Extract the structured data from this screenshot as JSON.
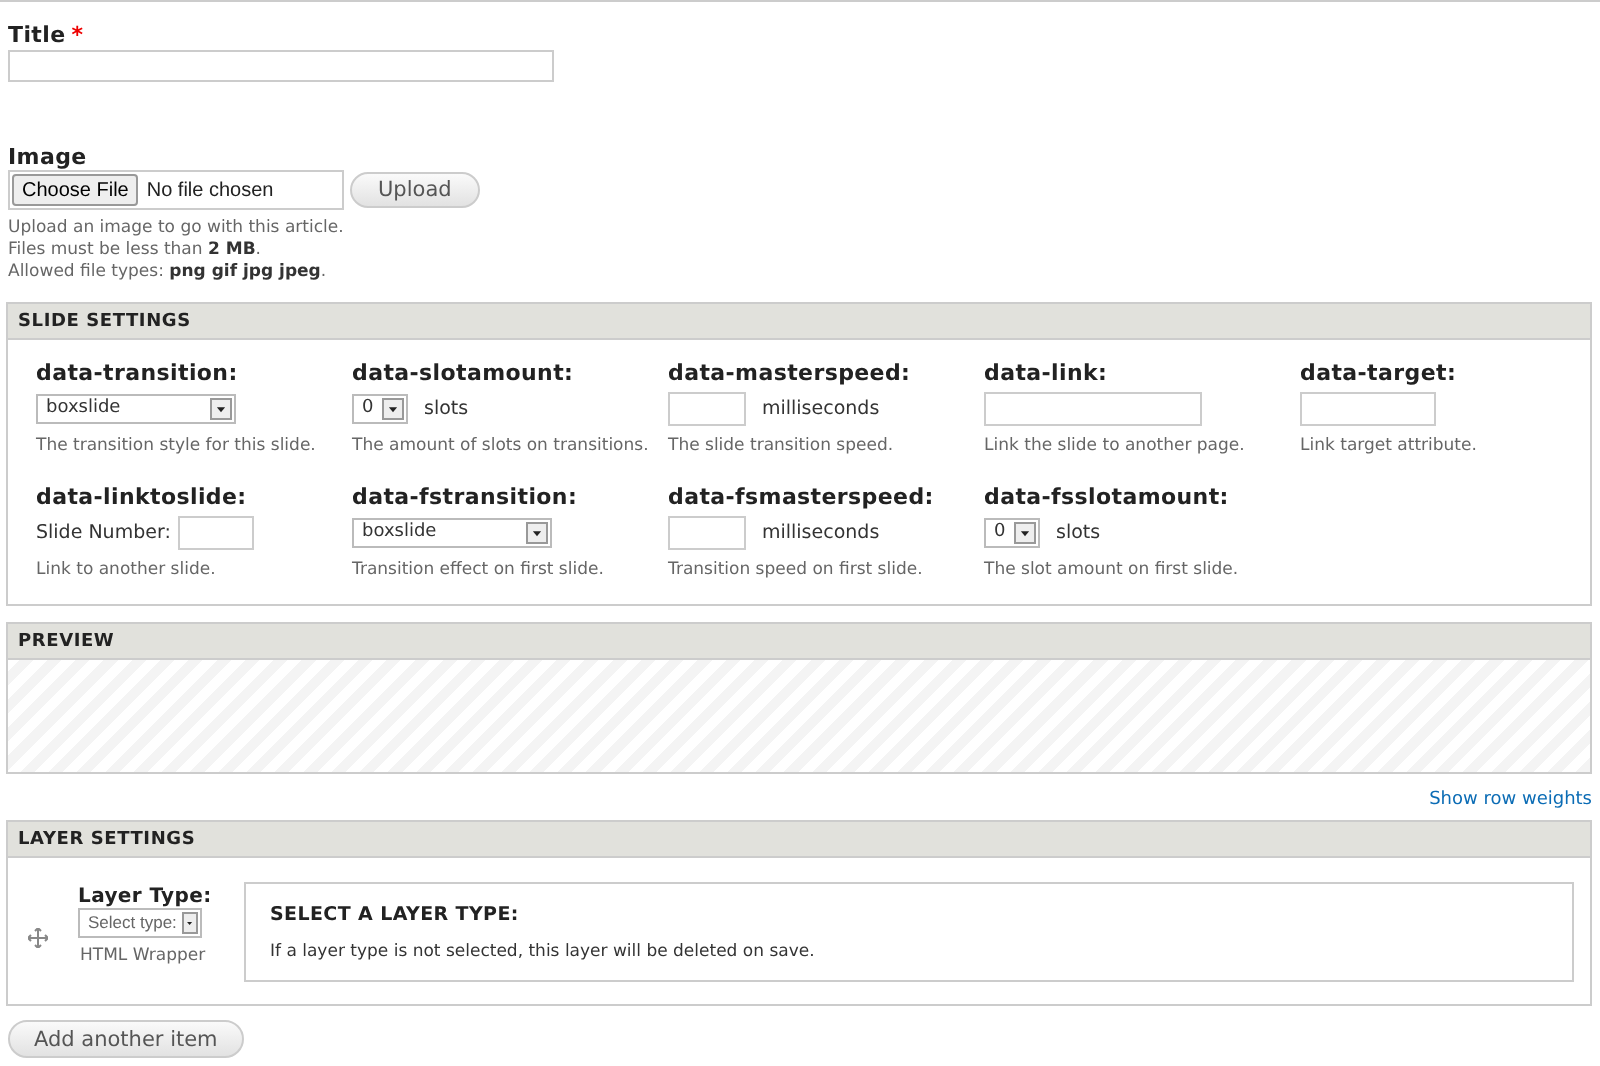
{
  "title_field": {
    "label": "Title",
    "required": true,
    "marker": "*"
  },
  "image_field": {
    "label": "Image",
    "choose_button": "Choose File",
    "file_status": "No file chosen",
    "upload_button": "Upload",
    "help": [
      "Upload an image to go with this article.",
      "Files must be less than **2 MB**.",
      "Allowed file types: **png gif jpg jpeg**."
    ]
  },
  "slide_settings": {
    "heading": "SLIDE SETTINGS",
    "fields": [
      {
        "label": "data-transition:",
        "kind": "select",
        "value": "boxslide",
        "help": "The transition style for this slide."
      },
      {
        "label": "data-slotamount:",
        "kind": "small-select",
        "value": "0",
        "suffix": "slots",
        "help": "The amount of slots on transitions."
      },
      {
        "label": "data-masterspeed:",
        "kind": "short-input",
        "suffix": "milliseconds",
        "help": "The slide transition speed."
      },
      {
        "label": "data-link:",
        "kind": "wide-input",
        "help": "Link the slide to another page."
      },
      {
        "label": "data-target:",
        "kind": "input",
        "help": "Link target attribute."
      },
      {
        "label": "data-linktoslide:",
        "kind": "prefixed-input",
        "prefix": "Slide Number:",
        "help": "Link to another slide."
      },
      {
        "label": "data-fstransition:",
        "kind": "select",
        "value": "boxslide",
        "help": "Transition effect on first slide."
      },
      {
        "label": "data-fsmasterspeed:",
        "kind": "short-input",
        "suffix": "milliseconds",
        "help": "Transition speed on first slide."
      },
      {
        "label": "data-fsslotamount:",
        "kind": "small-select",
        "value": "0",
        "suffix": "slots",
        "help": "The slot amount on first slide."
      }
    ]
  },
  "preview": {
    "heading": "PREVIEW"
  },
  "show_row_weights": "Show row weights",
  "layer_settings": {
    "heading": "LAYER SETTINGS",
    "layer_type_label": "Layer Type:",
    "select_placeholder": "Select type:",
    "caption": "HTML Wrapper",
    "panel_heading": "SELECT A LAYER TYPE:",
    "panel_message": "If a layer type is not selected, this layer will be deleted on save."
  },
  "add_button": "Add another item"
}
